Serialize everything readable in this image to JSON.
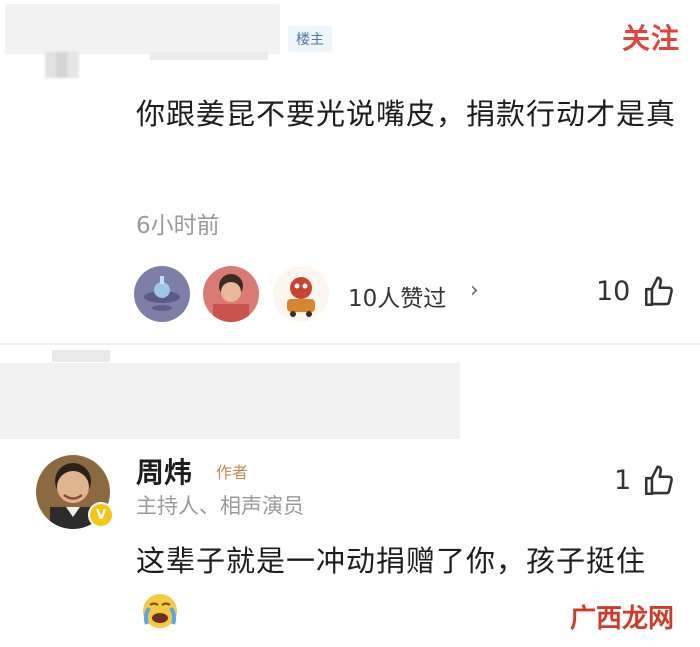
{
  "top_comment": {
    "op_badge": "楼主",
    "follow_label": "关注",
    "text": "你跟姜昆不要光说嘴皮，捐款行动才是真",
    "time": "6小时前",
    "likers_text": "10人赞过",
    "likers_chevron": "›",
    "like_count": "10"
  },
  "reply": {
    "author_name": "周炜",
    "author_tag": "作者",
    "verified_mark": "V",
    "author_title": "主持人、相声演员",
    "like_count": "1",
    "text": "这辈子就是一冲动捐赠了你，孩子挺住"
  },
  "watermark": "广西龙网",
  "colors": {
    "accent_red": "#e0443a",
    "badge_blue": "#4a78a8",
    "tag_orange": "#c78a55",
    "verified_yellow": "#f5c518"
  },
  "icons": [
    "thumbs-up-icon",
    "crying-emoji-icon",
    "verified-badge-icon",
    "chevron-right-icon"
  ]
}
